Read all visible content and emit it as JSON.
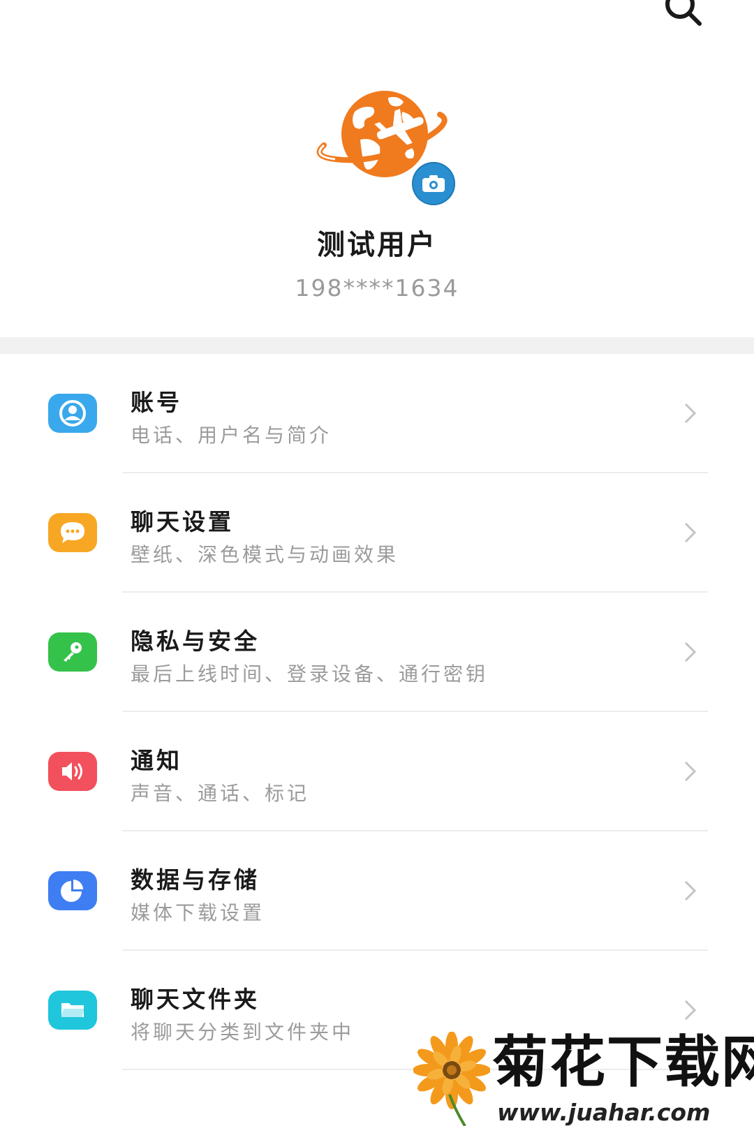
{
  "header": {
    "search_icon": "search-icon",
    "avatar_icon": "globe-airplane-avatar",
    "camera_icon": "camera-icon",
    "profile_name": "测试用户",
    "profile_phone": "198****1634"
  },
  "colors": {
    "avatar_orange": "#f07a1e",
    "camera_blue": "#2a8fd0",
    "account": "#39a8ec",
    "chat": "#f7a724",
    "privacy": "#35c24a",
    "notify": "#f2505c",
    "data": "#3e7ef2",
    "folder": "#1fc6dc"
  },
  "menu": {
    "items": [
      {
        "title": "账号",
        "subtitle": "电话、用户名与简介",
        "icon": "account-icon"
      },
      {
        "title": "聊天设置",
        "subtitle": "壁纸、深色模式与动画效果",
        "icon": "chat-bubble-icon"
      },
      {
        "title": "隐私与安全",
        "subtitle": "最后上线时间、登录设备、通行密钥",
        "icon": "key-icon"
      },
      {
        "title": "通知",
        "subtitle": "声音、通话、标记",
        "icon": "speaker-icon"
      },
      {
        "title": "数据与存储",
        "subtitle": "媒体下载设置",
        "icon": "pie-chart-icon"
      },
      {
        "title": "聊天文件夹",
        "subtitle": "将聊天分类到文件夹中",
        "icon": "folder-icon"
      }
    ]
  },
  "watermark": {
    "title": "菊花下载网",
    "url": "www.juahar.com"
  }
}
